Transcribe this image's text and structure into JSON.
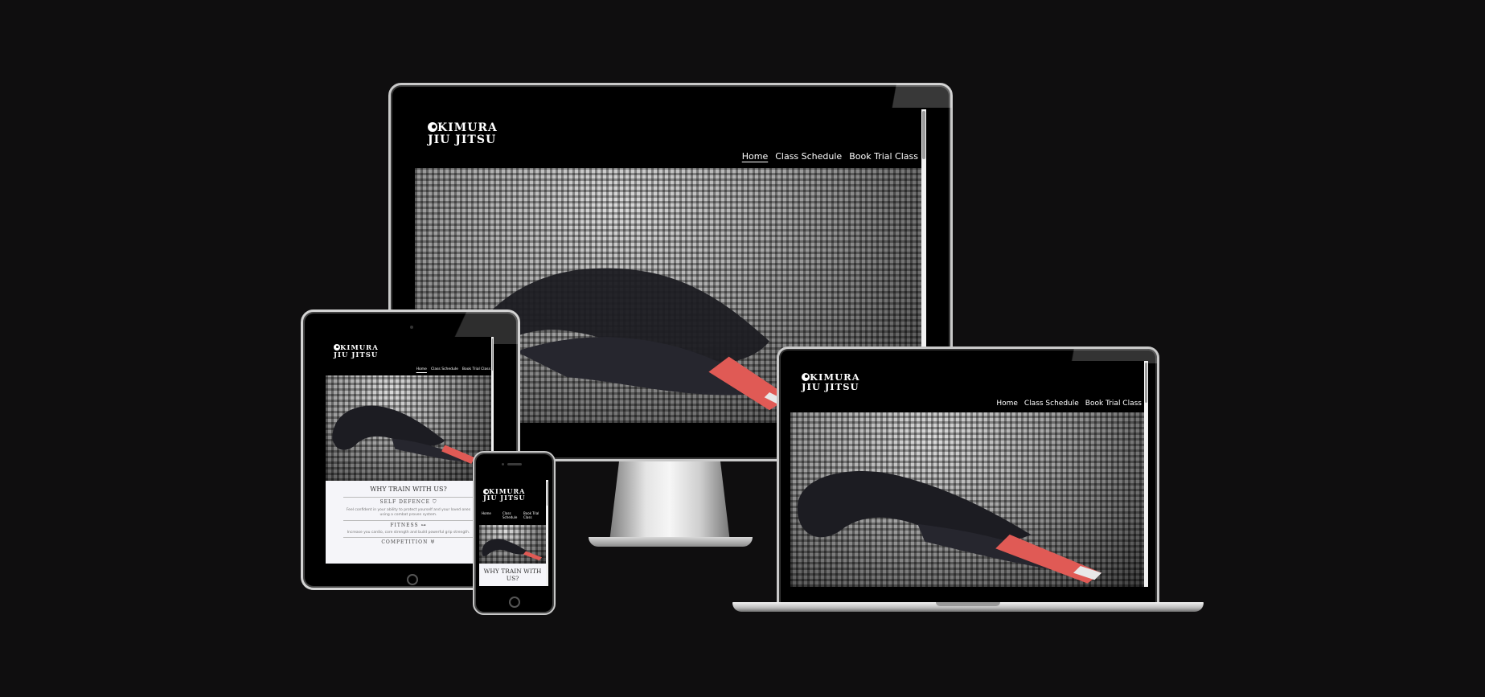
{
  "site": {
    "logo": {
      "line1": "KIMURA",
      "line2": "JIU JITSU"
    },
    "nav": {
      "home": "Home",
      "schedule": "Class Schedule",
      "trial": "Book Trial Class"
    }
  },
  "tablet_content": {
    "heading": "WHY TRAIN WITH US?",
    "sections": [
      {
        "title": "SELF DEFENCE",
        "icon": "shield-icon",
        "text": "Feel confident in your ability to protect yourself and your loved ones using a combat proven system."
      },
      {
        "title": "FITNESS",
        "icon": "dumbbell-icon",
        "text": "Increase you cardio, core strength and build powerful grip strength."
      },
      {
        "title": "COMPETITION",
        "icon": "trophy-icon",
        "text": ""
      }
    ]
  },
  "phone_content": {
    "heading": "WHY TRAIN WITH US?"
  },
  "colors": {
    "background": "#0f0e0f",
    "header": "#000000",
    "belt": "#1c1c22",
    "belt_tip": "#e05a55",
    "content_bg": "#f5f5f9"
  }
}
